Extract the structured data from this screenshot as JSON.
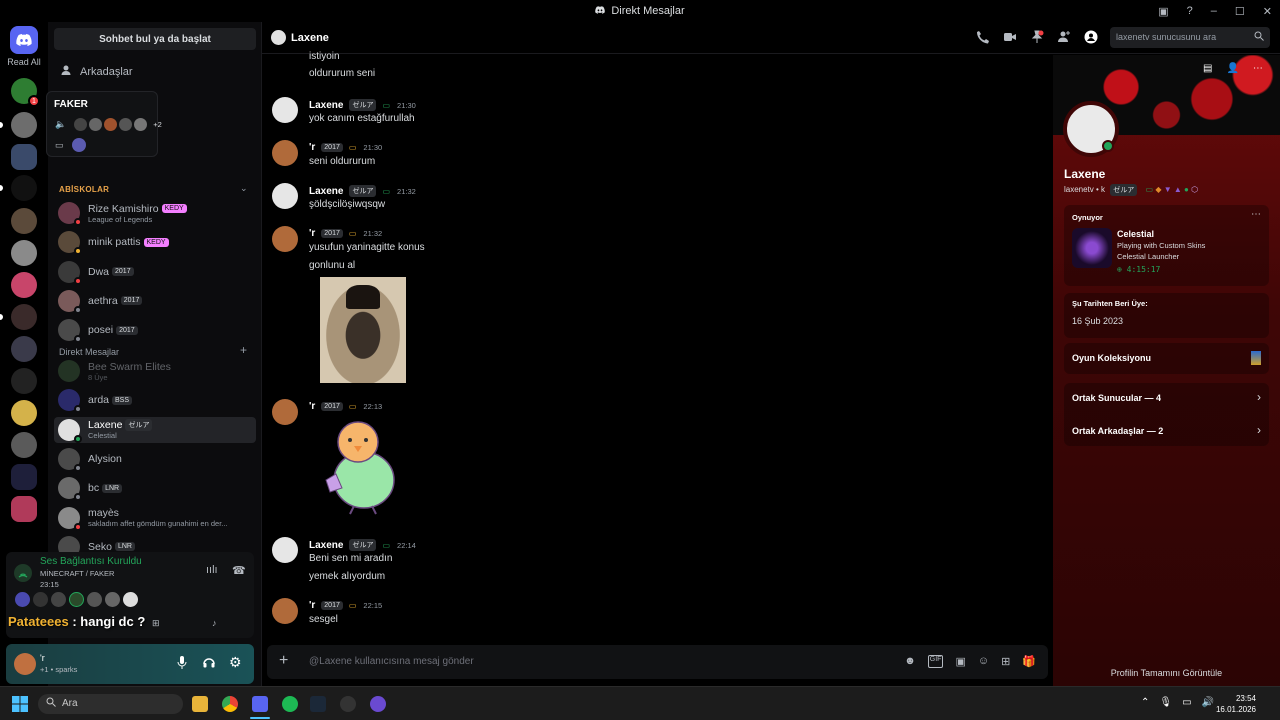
{
  "window": {
    "title": "Direkt Mesajlar"
  },
  "rail": {
    "read_all": "Read All"
  },
  "sidebar": {
    "find_button": "Sohbet bul ya da başlat",
    "friends_label": "Arkadaşlar",
    "section_abiskolar": "ABİSKOLAR",
    "section_dm": "Direkt Mesajlar",
    "dm_plus": "+",
    "tooltip": {
      "title": "FAKER",
      "count": "+2"
    },
    "abiskolar": [
      {
        "name": "Rize Kamishiro",
        "tag": "KEDY",
        "sub": "League of Legends",
        "status": "#f23f43"
      },
      {
        "name": "minik pattis",
        "tag": "KEDY",
        "sub": "",
        "status": "#f0b232"
      },
      {
        "name": "Dwa",
        "tag": "2017",
        "sub": "",
        "status": "#f23f43"
      },
      {
        "name": "aethra",
        "tag": "2017",
        "sub": "",
        "status": "#80848e"
      },
      {
        "name": "posei",
        "tag": "2017",
        "sub": "",
        "status": "#80848e"
      }
    ],
    "dms": [
      {
        "name": "Bee Swarm Elites",
        "tag": "",
        "sub": "8 Üye",
        "dim": true
      },
      {
        "name": "arda",
        "tag": "BSS",
        "sub": "",
        "status": "#80848e"
      },
      {
        "name": "Laxene",
        "tag": "ゼルア",
        "sub": "Celestial",
        "status": "#23a55a",
        "active": true
      },
      {
        "name": "Alysion",
        "tag": "",
        "sub": "",
        "status": "#80848e"
      },
      {
        "name": "bc",
        "tag": "LNR",
        "sub": "",
        "status": "#80848e"
      },
      {
        "name": "mayès",
        "tag": "",
        "sub": "sakladım affet gömdüm gunahimi en der...",
        "status": "#f23f43"
      },
      {
        "name": "Seko",
        "tag": "LNR",
        "sub": "",
        "status": "#f23f43"
      }
    ]
  },
  "voice": {
    "status": "Ses Bağlantısı Kuruldu",
    "channel": "MİNECRAFT / FAKER",
    "time": "23:15"
  },
  "overlay": {
    "user": "Patateees",
    "sep": " : ",
    "text": "hangi dc ?"
  },
  "userbar": {
    "name": "'r",
    "status": "+1 • sparks"
  },
  "chat": {
    "header_name": "Laxene",
    "search_placeholder": "laxenetv sunucusunu ara",
    "composer_placeholder": "@Laxene kullanıcısına mesaj gönder",
    "top_lines": [
      "istiyoin",
      "oldururum seni"
    ],
    "messages": [
      {
        "author": "Laxene",
        "tag": "ゼルア",
        "time": "21:30",
        "lines": [
          "yok canım estağfurullah"
        ]
      },
      {
        "author": "'r",
        "tag": "2017",
        "time": "21:30",
        "lines": [
          "seni oldururum"
        ]
      },
      {
        "author": "Laxene",
        "tag": "ゼルア",
        "time": "21:32",
        "lines": [
          "şöldşcilöşiwqsqw"
        ]
      },
      {
        "author": "'r",
        "tag": "2017",
        "time": "21:32",
        "lines": [
          "yusufun yaninagitte konus",
          "gonlunu al"
        ]
      },
      {
        "author": "'r",
        "tag": "2017",
        "time": "22:13",
        "lines": []
      },
      {
        "author": "Laxene",
        "tag": "ゼルア",
        "time": "22:14",
        "lines": [
          "Beni sen mi aradın",
          "yemek alıyordum"
        ]
      },
      {
        "author": "'r",
        "tag": "2017",
        "time": "22:15",
        "lines": [
          "sesgel"
        ]
      }
    ]
  },
  "profile": {
    "name": "Laxene",
    "sub": "laxenetv • k",
    "sub_tag": "ゼルア",
    "playing_label": "Oynuyor",
    "game_name": "Celestial",
    "game_line1": "Playing with Custom Skins",
    "game_line2": "Celestial Launcher",
    "game_time": "4:15:17",
    "member_label": "Şu Tarihten Beri Üye:",
    "member_date": "16 Şub 2023",
    "collection": "Oyun Koleksiyonu",
    "mutual_servers": "Ortak Sunucular — 4",
    "mutual_friends": "Ortak Arkadaşlar — 2",
    "view_full": "Profilin Tamamını Görüntüle"
  },
  "taskbar": {
    "search": "Ara",
    "time": "23:54",
    "date": "16.01.2026"
  },
  "colors": {
    "online": "#23a55a",
    "dnd": "#f23f43",
    "idle": "#f0b232",
    "offline": "#80848e",
    "accent": "#5865f2"
  }
}
